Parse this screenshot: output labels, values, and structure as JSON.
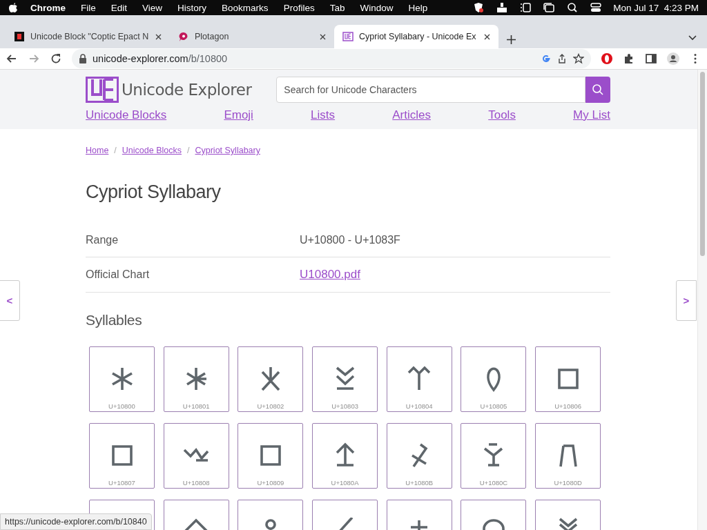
{
  "menu_bar": {
    "app": "Chrome",
    "items": [
      "File",
      "Edit",
      "View",
      "History",
      "Bookmarks",
      "Profiles",
      "Tab",
      "Window",
      "Help"
    ],
    "clock": "Mon Jul 17  4:23 PM"
  },
  "tabs": [
    {
      "title": "Unicode Block \"Coptic Epact N",
      "selected": false,
      "kind": "coptic"
    },
    {
      "title": "Plotagon",
      "selected": false,
      "kind": "plotagon"
    },
    {
      "title": "Cypriot Syllabary - Unicode Ex",
      "selected": true,
      "kind": "ue"
    }
  ],
  "address_bar": {
    "domain": "unicode-explorer.com",
    "path": "/b/10800"
  },
  "site": {
    "name": "Unicode Explorer",
    "search_placeholder": "Search for Unicode Characters",
    "nav": [
      "Unicode Blocks",
      "Emoji",
      "Lists",
      "Articles",
      "Tools",
      "My List"
    ]
  },
  "breadcrumbs": [
    "Home",
    "Unicode Blocks",
    "Cypriot Syllabary"
  ],
  "breadcrumb_separator": "/",
  "page_title": "Cypriot Syllabary",
  "info_rows": [
    {
      "label": "Range",
      "value": "U+10800 - U+1083F",
      "kind": "text"
    },
    {
      "label": "Official Chart",
      "value": "U10800.pdf",
      "kind": "link"
    }
  ],
  "pager": {
    "prev": "<",
    "next": ">"
  },
  "section_title": "Syllables",
  "tiles": [
    {
      "code": "U+10800"
    },
    {
      "code": "U+10801"
    },
    {
      "code": "U+10802"
    },
    {
      "code": "U+10803"
    },
    {
      "code": "U+10804"
    },
    {
      "code": "U+10805"
    },
    {
      "code": "U+10806"
    },
    {
      "code": "U+10807"
    },
    {
      "code": "U+10808"
    },
    {
      "code": "U+10809"
    },
    {
      "code": "U+1080A"
    },
    {
      "code": "U+1080B"
    },
    {
      "code": "U+1080C"
    },
    {
      "code": "U+1080D"
    },
    {
      "kind": "covered"
    },
    {
      "kind": "cut"
    },
    {
      "kind": "cut"
    },
    {
      "kind": "cut"
    },
    {
      "kind": "cut"
    },
    {
      "kind": "cut"
    },
    {
      "kind": "cut"
    }
  ],
  "status_url": "https://unicode-explorer.com/b/10840"
}
